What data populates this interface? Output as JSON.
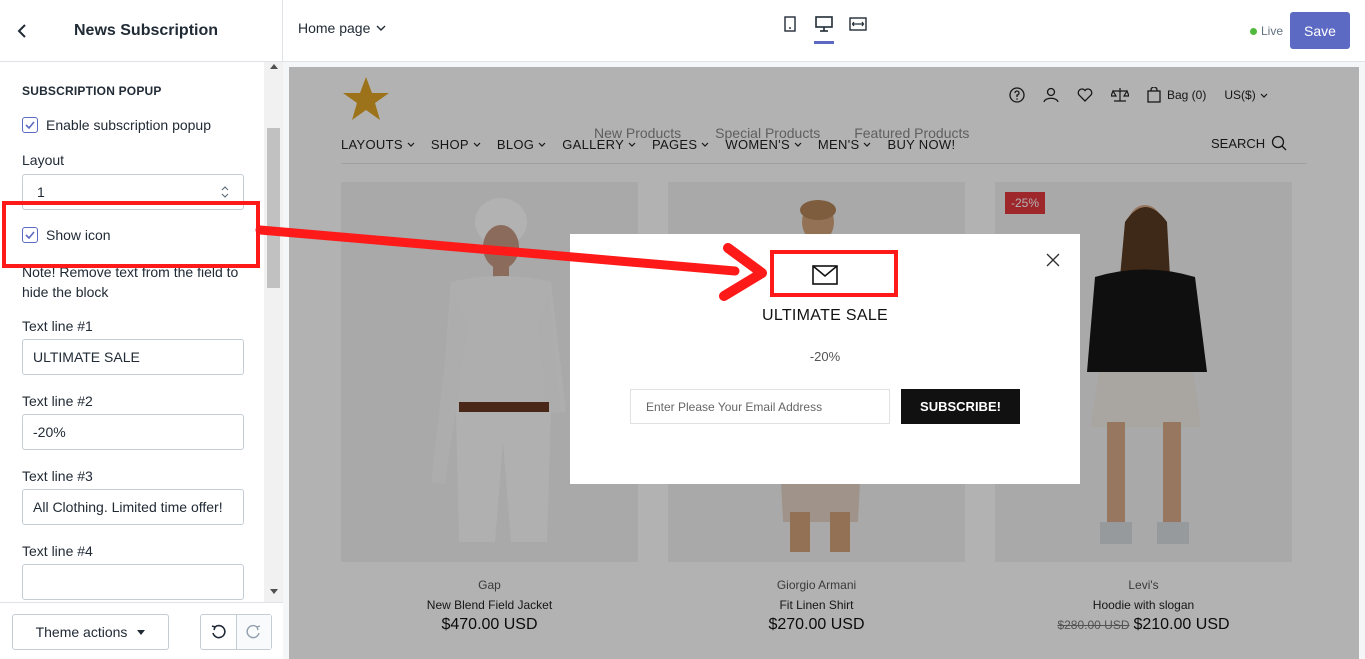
{
  "topbar": {
    "panel_title": "News Subscription",
    "page_selector": "Home page",
    "live_label": "Live",
    "save_label": "Save",
    "colors": {
      "accent": "#5c6ac4",
      "live": "#50b83c"
    }
  },
  "sidebar": {
    "section_heading": "SUBSCRIPTION POPUP",
    "enable_popup_label": "Enable subscription popup",
    "layout_label": "Layout",
    "layout_value": "1",
    "show_icon_label": "Show icon",
    "note": "Note! Remove text from the field to hide the block",
    "text_line_1_label": "Text line #1",
    "text_line_1_value": "ULTIMATE SALE",
    "text_line_2_label": "Text line #2",
    "text_line_2_value": "-20%",
    "text_line_3_label": "Text line #3",
    "text_line_3_value": "All Clothing. Limited time offer!",
    "text_line_4_label": "Text line #4",
    "text_line_4_value": ""
  },
  "footer": {
    "theme_actions_label": "Theme actions"
  },
  "store": {
    "header": {
      "bag_label": "Bag (0)",
      "currency": "US($)"
    },
    "nav": [
      "LAYOUTS",
      "SHOP",
      "BLOG",
      "GALLERY",
      "PAGES",
      "WOMEN'S",
      "MEN'S",
      "BUY NOW!"
    ],
    "ghost_tabs": [
      "New Products",
      "Special Products",
      "Featured Products"
    ],
    "search_label": "SEARCH",
    "products": [
      {
        "brand": "Gap",
        "name": "New Blend Field Jacket",
        "old_price": "",
        "price": "$470.00 USD",
        "badge": ""
      },
      {
        "brand": "Giorgio Armani",
        "name": "Fit Linen Shirt",
        "old_price": "",
        "price": "$270.00 USD",
        "badge": ""
      },
      {
        "brand": "Levi's",
        "name": "Hoodie with slogan",
        "old_price": "$280.00 USD",
        "price": "$210.00 USD",
        "badge": "-25%"
      }
    ]
  },
  "popup": {
    "icon": "envelope-icon",
    "title": "ULTIMATE SALE",
    "subtitle": "-20%",
    "email_placeholder": "Enter Please Your Email Address",
    "subscribe_label": "SUBSCRIBE!"
  },
  "annotation_color": "#ff1a1a"
}
